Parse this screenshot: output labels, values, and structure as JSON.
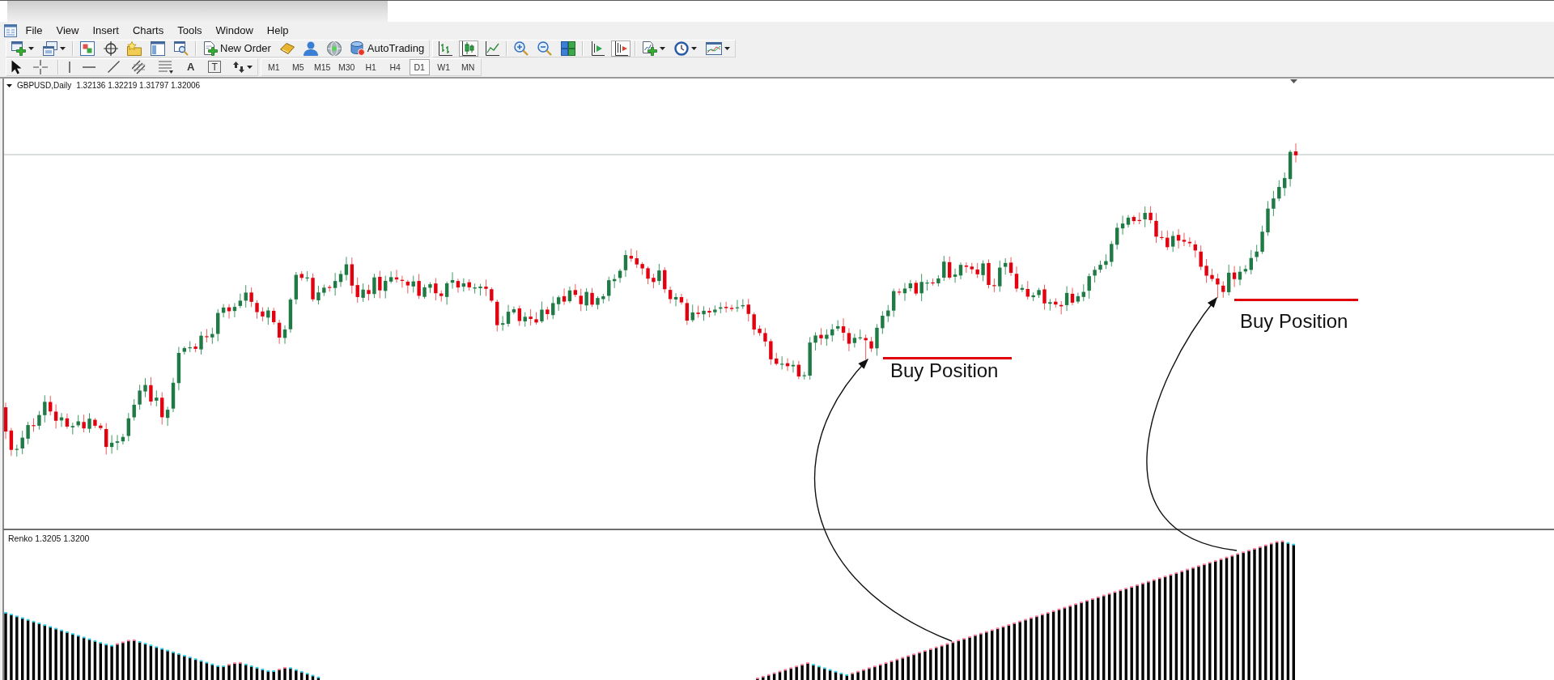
{
  "menu_bar": {
    "items": [
      "File",
      "View",
      "Insert",
      "Charts",
      "Tools",
      "Window",
      "Help"
    ]
  },
  "standard_toolbar": {
    "new_order_label": "New Order",
    "autotrading_label": "AutoTrading",
    "chart_types": [
      {
        "kind": "bars",
        "selected": false
      },
      {
        "kind": "candles",
        "selected": true
      },
      {
        "kind": "line",
        "selected": false
      }
    ],
    "scroll_toggles": [
      {
        "kind": "auto-scroll",
        "on": false
      },
      {
        "kind": "chart-shift",
        "on": true
      }
    ]
  },
  "line_studies_toolbar": {
    "text_tool": "A",
    "text_label_tool": "T",
    "timeframes": [
      {
        "label": "M1",
        "selected": false
      },
      {
        "label": "M5",
        "selected": false
      },
      {
        "label": "M15",
        "selected": false
      },
      {
        "label": "M30",
        "selected": false
      },
      {
        "label": "H1",
        "selected": false
      },
      {
        "label": "H4",
        "selected": false
      },
      {
        "label": "D1",
        "selected": true
      },
      {
        "label": "W1",
        "selected": false
      },
      {
        "label": "MN",
        "selected": false
      }
    ]
  },
  "chart": {
    "symbol": "GBPUSD,Daily",
    "quotes": "1.32136 1.32219 1.31797 1.32006",
    "annotations": [
      {
        "label": "Buy Position"
      },
      {
        "label": "Buy Position"
      }
    ]
  },
  "indicator_window": {
    "label": "Renko 1.3205 1.3200"
  }
}
